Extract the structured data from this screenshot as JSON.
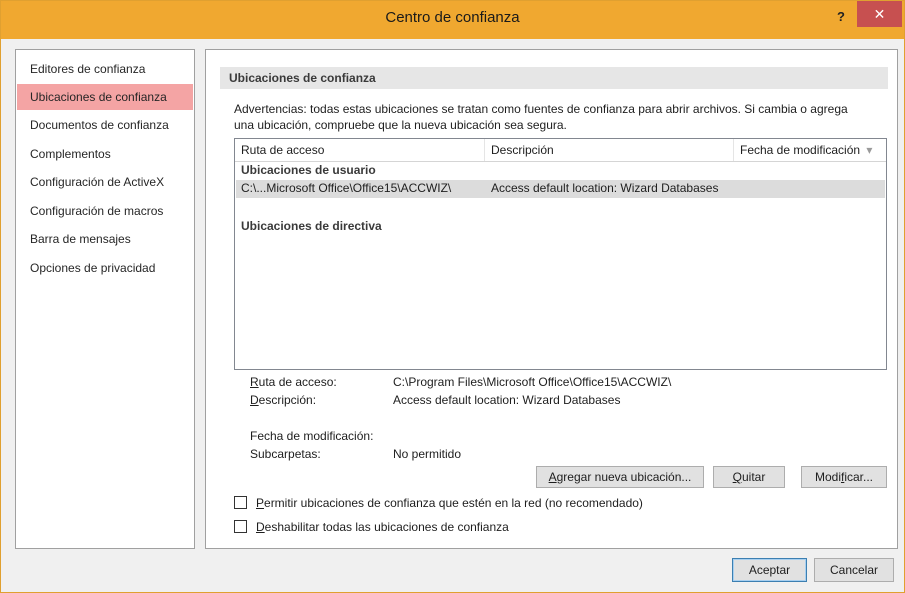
{
  "window": {
    "title": "Centro de confianza",
    "help_label": "?",
    "close_label": "✕"
  },
  "nav": {
    "items": [
      {
        "label": "Editores de confianza",
        "selected": false
      },
      {
        "label": "Ubicaciones de confianza",
        "selected": true
      },
      {
        "label": "Documentos de confianza",
        "selected": false
      },
      {
        "label": "Complementos",
        "selected": false
      },
      {
        "label": "Configuración de ActiveX",
        "selected": false
      },
      {
        "label": "Configuración de macros",
        "selected": false
      },
      {
        "label": "Barra de mensajes",
        "selected": false
      },
      {
        "label": "Opciones de privacidad",
        "selected": false
      }
    ]
  },
  "main": {
    "section_title": "Ubicaciones de confianza",
    "warning_line1": "Advertencias: todas estas ubicaciones se tratan como fuentes de confianza para abrir archivos. Si cambia o agrega",
    "warning_line2": "una ubicación, compruebe que la nueva ubicación sea segura.",
    "columns": [
      "Ruta de acceso",
      "Descripción",
      "Fecha de modificación"
    ],
    "sort_indicator": "▾",
    "groups": {
      "user": "Ubicaciones de usuario",
      "policy": "Ubicaciones de directiva"
    },
    "rows": [
      {
        "path": "C:\\...Microsoft Office\\Office15\\ACCWIZ\\",
        "description": "Access default location: Wizard Databases",
        "modified": ""
      }
    ],
    "details": {
      "path_label_key": "R",
      "path_label_rest": "uta de acceso:",
      "path_value": "C:\\Program Files\\Microsoft Office\\Office15\\ACCWIZ\\",
      "desc_label_key": "D",
      "desc_label_rest": "escripción:",
      "desc_value": "Access default location: Wizard Databases",
      "modified_label": "Fecha de modificación:",
      "modified_value": "",
      "subfolders_label": "Subcarpetas:",
      "subfolders_value": "No permitido"
    },
    "buttons": {
      "add_key": "A",
      "add_rest": "gregar nueva ubicación...",
      "remove_key": "Q",
      "remove_rest": "uitar",
      "modify_pre": "Modi",
      "modify_key": "f",
      "modify_rest": "icar..."
    },
    "checkboxes": {
      "network_key": "P",
      "network_rest": "ermitir ubicaciones de confianza que estén en la red (no recomendado)",
      "network_checked": false,
      "disable_key": "D",
      "disable_rest": "eshabilitar todas las ubicaciones de confianza",
      "disable_checked": false
    }
  },
  "footer": {
    "ok_label": "Aceptar",
    "cancel_label": "Cancelar"
  },
  "colors": {
    "titlebar": "#f0a830",
    "selected_nav": "#f4a4a4",
    "close_button": "#c75050"
  }
}
